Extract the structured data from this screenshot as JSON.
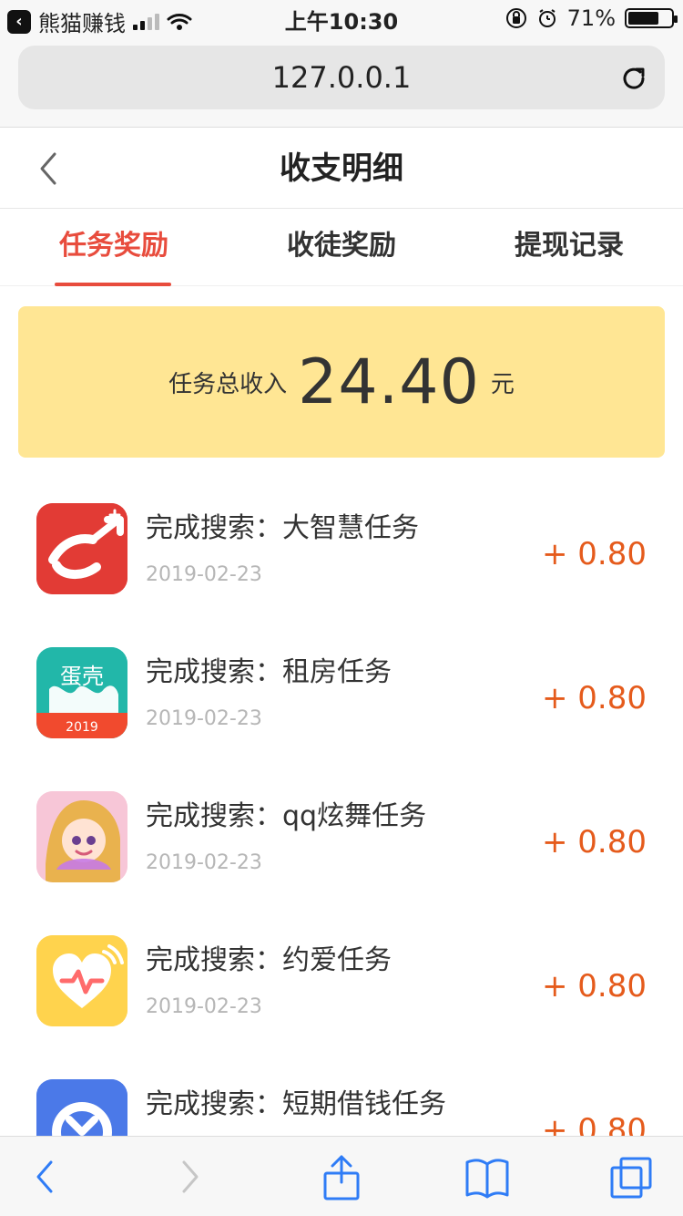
{
  "status_bar": {
    "back_app": "熊猫赚钱",
    "time": "上午10:30",
    "battery": "71%",
    "battery_level": 0.71
  },
  "url_bar": {
    "url": "127.0.0.1"
  },
  "header": {
    "title": "收支明细"
  },
  "tabs": [
    {
      "label": "任务奖励",
      "active": true
    },
    {
      "label": "收徒奖励",
      "active": false
    },
    {
      "label": "提现记录",
      "active": false
    }
  ],
  "summary": {
    "label": "任务总收入",
    "amount": "24.40",
    "unit": "元"
  },
  "items": [
    {
      "title": "完成搜索：大智慧任务",
      "date": "2019-02-23",
      "amount": "+ 0.80",
      "icon": "dazhihui-app-icon"
    },
    {
      "title": "完成搜索：租房任务",
      "date": "2019-02-23",
      "amount": "+ 0.80",
      "icon": "danke-app-icon",
      "icon_text": "蛋壳",
      "icon_year": "2019"
    },
    {
      "title": "完成搜索：qq炫舞任务",
      "date": "2019-02-23",
      "amount": "+ 0.80",
      "icon": "qqdance-app-icon"
    },
    {
      "title": "完成搜索：约爱任务",
      "date": "2019-02-23",
      "amount": "+ 0.80",
      "icon": "yueai-app-icon"
    },
    {
      "title": "完成搜索：短期借钱任务",
      "date": "",
      "amount": "+ 0.80",
      "icon": "loan-app-icon"
    }
  ],
  "colors": {
    "accent": "#e84c3d",
    "amount": "#e55b1c",
    "summary_bg": "#ffe694"
  }
}
